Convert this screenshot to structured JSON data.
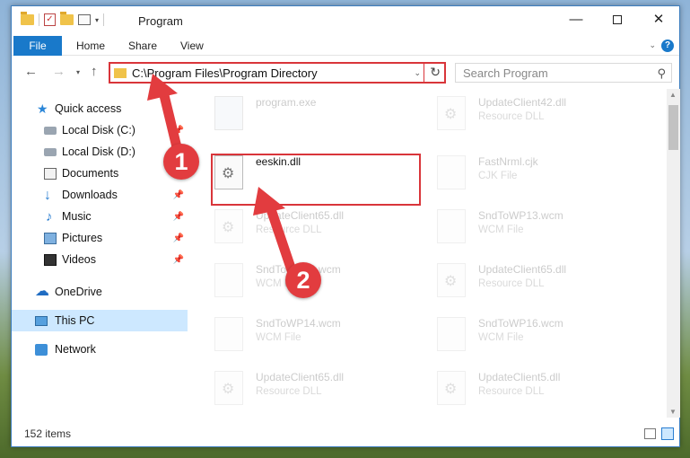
{
  "window": {
    "title": "Program",
    "minimize_glyph": "—",
    "close_glyph": "✕",
    "qat_check_glyph": "✓",
    "qat_caret_glyph": "▾"
  },
  "ribbon": {
    "tabs": [
      "File",
      "Home",
      "Share",
      "View"
    ],
    "expand_glyph": "⌄",
    "help_glyph": "?"
  },
  "nav": {
    "back_glyph": "←",
    "forward_glyph": "→",
    "history_glyph": "▾",
    "up_glyph": "↑",
    "address": "C:\\Program Files\\Program Directory",
    "address_dropdown_glyph": "⌄",
    "refresh_glyph": "↻",
    "search_placeholder": "Search Program",
    "search_glyph": "⚲"
  },
  "sidebar": {
    "items": [
      {
        "label": "Quick access",
        "icon": "star-icon",
        "glyph": "★"
      },
      {
        "label": "Local Disk (C:)",
        "icon": "drive-icon",
        "pin": "📌"
      },
      {
        "label": "Local Disk (D:)",
        "icon": "drive-icon"
      },
      {
        "label": "Documents",
        "icon": "documents-icon",
        "pin": "📌"
      },
      {
        "label": "Downloads",
        "icon": "downloads-icon",
        "glyph": "↓",
        "pin": "📌"
      },
      {
        "label": "Music",
        "icon": "music-icon",
        "glyph": "♪",
        "pin": "📌"
      },
      {
        "label": "Pictures",
        "icon": "pictures-icon",
        "pin": "📌"
      },
      {
        "label": "Videos",
        "icon": "videos-icon",
        "pin": "📌"
      },
      {
        "label": "OneDrive",
        "icon": "cloud-icon",
        "glyph": "☁"
      },
      {
        "label": "This PC",
        "icon": "computer-icon",
        "selected": true
      },
      {
        "label": "Network",
        "icon": "network-icon"
      }
    ]
  },
  "files": {
    "gear_glyph": "⚙",
    "items": [
      {
        "name": "program.exe",
        "type": ""
      },
      {
        "name": "UpdateClient42.dll",
        "type": "Resource DLL"
      },
      {
        "name": "eeskin.dll",
        "type": "",
        "highlighted": true
      },
      {
        "name": "FastNrml.cjk",
        "type": "CJK File"
      },
      {
        "name": "UpdateClient65.dll",
        "type": "Resource DLL"
      },
      {
        "name": "SndToWP13.wcm",
        "type": "WCM File"
      },
      {
        "name": "SndToWP16.wcm",
        "type": "WCM File"
      },
      {
        "name": "UpdateClient65.dll",
        "type": "Resource DLL"
      },
      {
        "name": "SndToWP14.wcm",
        "type": "WCM File"
      },
      {
        "name": "SndToWP16.wcm",
        "type": "WCM File"
      },
      {
        "name": "UpdateClient65.dll",
        "type": "Resource DLL"
      },
      {
        "name": "UpdateClient5.dll",
        "type": "Resource DLL"
      }
    ]
  },
  "scrollbar": {
    "up_glyph": "▲",
    "down_glyph": "▼"
  },
  "status": {
    "item_count": "152 items"
  },
  "annotations": {
    "step1": "1",
    "step2": "2",
    "accent_color": "#e23c3f"
  }
}
